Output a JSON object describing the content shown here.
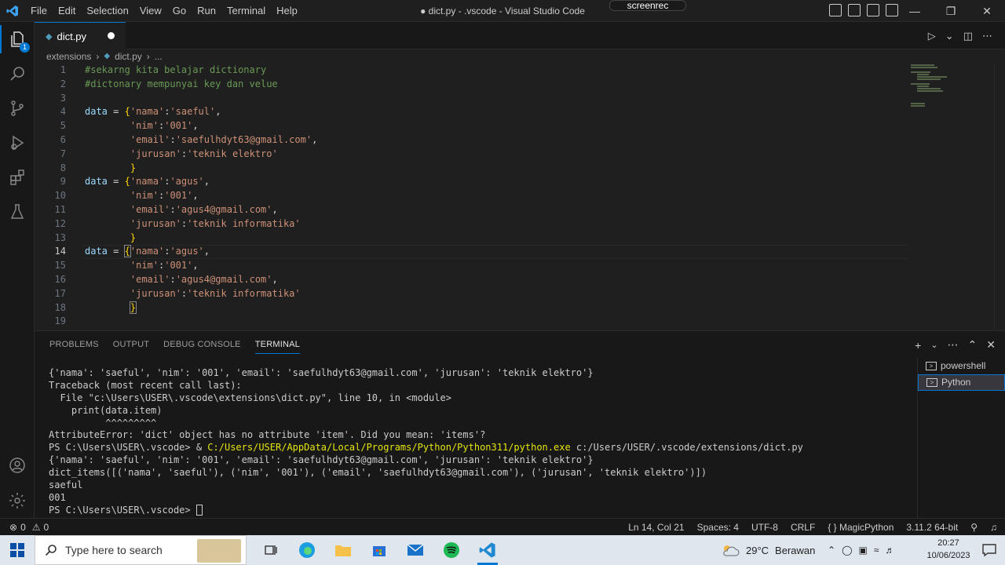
{
  "titlebar": {
    "menu": [
      "File",
      "Edit",
      "Selection",
      "View",
      "Go",
      "Run",
      "Terminal",
      "Help"
    ],
    "window_title": "● dict.py - .vscode - Visual Studio Code",
    "overlay": "screenrec"
  },
  "activitybar": {
    "explorer_badge": "1"
  },
  "tab": {
    "label": "dict.py"
  },
  "breadcrumb": {
    "folder": "extensions",
    "file": "dict.py",
    "more": "..."
  },
  "editor": {
    "line_numbers": [
      "1",
      "2",
      "3",
      "4",
      "5",
      "6",
      "7",
      "8",
      "9",
      "10",
      "11",
      "12",
      "13",
      "14",
      "15",
      "16",
      "17",
      "18",
      "19"
    ],
    "lines": [
      "#sekarng kita belajar dictionary",
      "#dictonary mempunyai key dan velue",
      "",
      "data = {'nama':'saeful',",
      "        'nim':'001',",
      "        'email':'saefulhdyt63@gmail.com',",
      "        'jurusan':'teknik elektro'",
      "        }",
      "data = {'nama':'agus',",
      "        'nim':'001',",
      "        'email':'agus4@gmail.com',",
      "        'jurusan':'teknik informatika'",
      "        }",
      "data = {'nama':'agus',",
      "        'nim':'001',",
      "        'email':'agus4@gmail.com',",
      "        'jurusan':'teknik informatika'",
      "        }",
      ""
    ],
    "active_line": "14"
  },
  "panel": {
    "tabs": [
      "PROBLEMS",
      "OUTPUT",
      "DEBUG CONSOLE",
      "TERMINAL"
    ],
    "active_tab": "TERMINAL",
    "terminals": [
      "powershell",
      "Python"
    ],
    "terminal_lines": [
      "{'nama': 'saeful', 'nim': '001', 'email': 'saefulhdyt63@gmail.com', 'jurusan': 'teknik elektro'}",
      "Traceback (most recent call last):",
      "  File \"c:\\Users\\USER\\.vscode\\extensions\\dict.py\", line 10, in <module>",
      "    print(data.item)",
      "          ^^^^^^^^^",
      "AttributeError: 'dict' object has no attribute 'item'. Did you mean: 'items'?",
      "PS C:\\Users\\USER\\.vscode> & ",
      "{'nama': 'saeful', 'nim': '001', 'email': 'saefulhdyt63@gmail.com', 'jurusan': 'teknik elektro'}",
      "dict_items([('nama', 'saeful'), ('nim', '001'), ('email', 'saefulhdyt63@gmail.com'), ('jurusan', 'teknik elektro')])",
      "saeful",
      "001",
      "PS C:\\Users\\USER\\.vscode> "
    ],
    "cmd_path": "C:/Users/USER/AppData/Local/Programs/Python/Python311/python.exe",
    "cmd_arg": " c:/Users/USER/.vscode/extensions/dict.py"
  },
  "statusbar": {
    "errors": "0",
    "warnings": "0",
    "position": "Ln 14, Col 21",
    "spaces": "Spaces: 4",
    "encoding": "UTF-8",
    "eol": "CRLF",
    "extension": "MagicPython",
    "interpreter": "3.11.2 64-bit"
  },
  "taskbar": {
    "search_placeholder": "Type here to search",
    "weather_temp": "29°C",
    "weather_desc": "Berawan",
    "time": "20:27",
    "date": "10/06/2023"
  },
  "colors": {
    "accent": "#0078d4",
    "string": "#ce9178",
    "comment": "#6a9955",
    "variable": "#9cdcfe",
    "brace": "#ffd700"
  }
}
